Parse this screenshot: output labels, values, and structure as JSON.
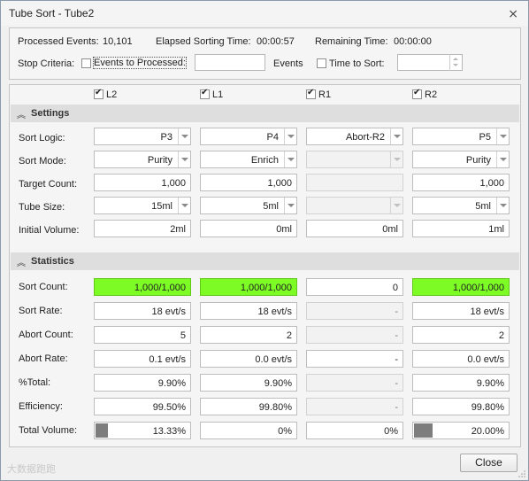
{
  "window": {
    "title": "Tube Sort - Tube2",
    "close_glyph": "⨯"
  },
  "summary": {
    "processed_label": "Processed Events:",
    "processed_value": "10,101",
    "elapsed_label": "Elapsed Sorting Time:",
    "elapsed_value": "00:00:57",
    "remaining_label": "Remaining Time:",
    "remaining_value": "00:00:00"
  },
  "stop": {
    "label": "Stop Criteria:",
    "events_checkbox_label": "Events to Processed:",
    "events_value": "",
    "events_unit": "Events",
    "time_checkbox_label": "Time to Sort:",
    "time_value": ""
  },
  "columns": [
    {
      "name": "L2",
      "checked": true
    },
    {
      "name": "L1",
      "checked": true
    },
    {
      "name": "R1",
      "checked": true
    },
    {
      "name": "R2",
      "checked": true
    }
  ],
  "settings": {
    "title": "Settings",
    "labels": {
      "sort_logic": "Sort Logic:",
      "sort_mode": "Sort Mode:",
      "target_count": "Target Count:",
      "tube_size": "Tube Size:",
      "initial_volume": "Initial Volume:"
    },
    "sort_logic": [
      "P3",
      "P4",
      "Abort-R2",
      "P5"
    ],
    "sort_mode": [
      "Purity",
      "Enrich",
      "",
      "Purity"
    ],
    "target_count": [
      "1,000",
      "1,000",
      "",
      "1,000"
    ],
    "tube_size": [
      "15ml",
      "5ml",
      "",
      "5ml"
    ],
    "initial_volume": [
      "2ml",
      "0ml",
      "0ml",
      "1ml"
    ]
  },
  "statistics": {
    "title": "Statistics",
    "labels": {
      "sort_count": "Sort Count:",
      "sort_rate": "Sort Rate:",
      "abort_count": "Abort Count:",
      "abort_rate": "Abort Rate:",
      "pct_total": "%Total:",
      "efficiency": "Efficiency:",
      "total_volume": "Total Volume:"
    },
    "sort_count": [
      "1,000/1,000",
      "1,000/1,000",
      "0",
      "1,000/1,000"
    ],
    "sort_rate": [
      "18 evt/s",
      "18 evt/s",
      "-",
      "18 evt/s"
    ],
    "abort_count": [
      "5",
      "2",
      "-",
      "2"
    ],
    "abort_rate": [
      "0.1 evt/s",
      "0.0 evt/s",
      "-",
      "0.0 evt/s"
    ],
    "pct_total": [
      "9.90%",
      "9.90%",
      "-",
      "9.90%"
    ],
    "efficiency": [
      "99.50%",
      "99.80%",
      "-",
      "99.80%"
    ],
    "total_volume": [
      "13.33%",
      "0%",
      "0%",
      "20.00%"
    ],
    "total_volume_fill": [
      0.1333,
      0,
      0,
      0.2
    ]
  },
  "colors": {
    "complete": "#7cfc24",
    "progress": "#7d7d7d",
    "section_bg": "#dedede"
  },
  "footer": {
    "close_label": "Close",
    "watermark": "大数据跑跑"
  }
}
